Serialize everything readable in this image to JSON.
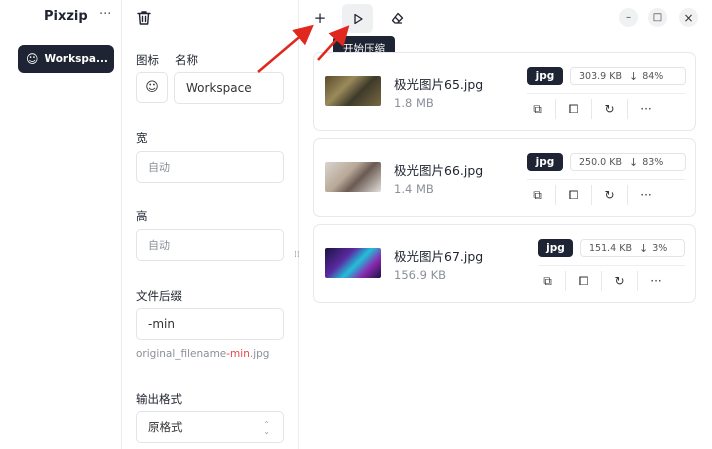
{
  "app": {
    "title": "Pixzip",
    "more_icon": "more-horizontal-icon"
  },
  "workspace": {
    "label": "Workspa...",
    "icon": "smile-icon"
  },
  "settings": {
    "icon_label": "图标",
    "name_label": "名称",
    "name_value": "Workspace",
    "width_label": "宽",
    "width_placeholder": "自动",
    "height_label": "高",
    "height_placeholder": "自动",
    "suffix_label": "文件后缀",
    "suffix_value": "-min",
    "hint_prefix": "original_filename",
    "hint_suffix": "-min",
    "hint_ext": ".jpg",
    "format_label": "输出格式",
    "format_value": "原格式"
  },
  "toolbar": {
    "add_icon": "plus-icon",
    "start_icon": "play-icon",
    "clear_icon": "eraser-icon",
    "tooltip": "开始压缩"
  },
  "window": {
    "minimize": "–",
    "maximize": "□",
    "close": "×"
  },
  "files": [
    {
      "name": "极光图片65.jpg",
      "size": "1.8 MB",
      "format": "jpg",
      "new_size": "303.9 KB",
      "ratio": "84%"
    },
    {
      "name": "极光图片66.jpg",
      "size": "1.4 MB",
      "format": "jpg",
      "new_size": "250.0 KB",
      "ratio": "83%"
    },
    {
      "name": "极光图片67.jpg",
      "size": "156.9 KB",
      "format": "jpg",
      "new_size": "151.4 KB",
      "ratio": "3%"
    }
  ],
  "colors": {
    "accent_dark": "#1e2433",
    "annotation_red": "#e0281f",
    "suffix_red": "#e5484d"
  }
}
